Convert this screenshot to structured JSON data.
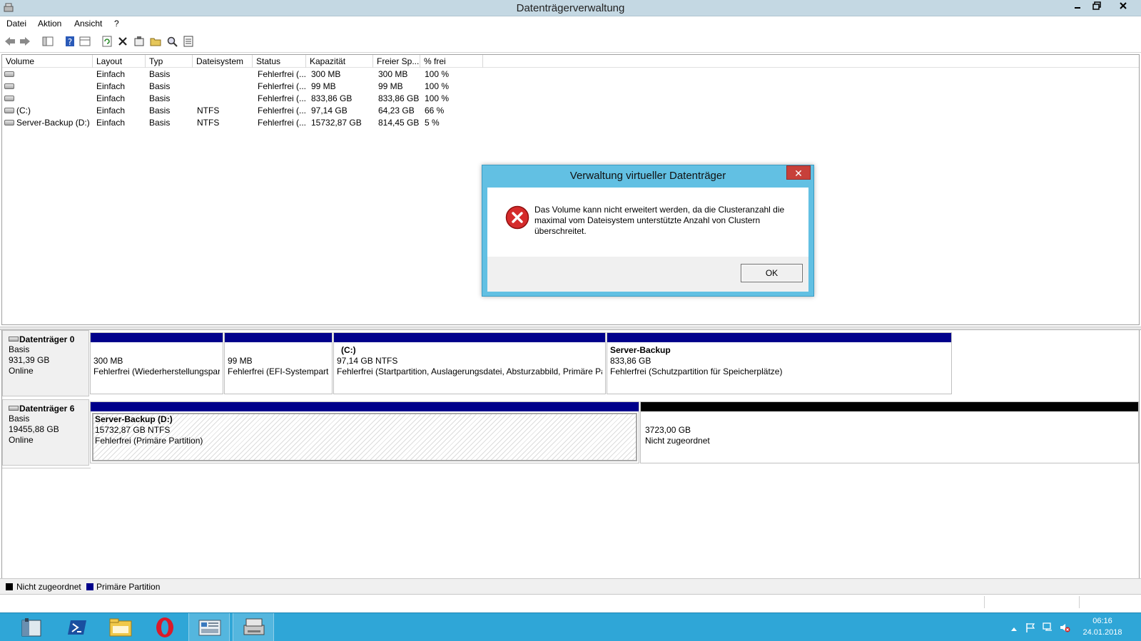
{
  "window": {
    "title": "Datenträgerverwaltung"
  },
  "menu": [
    "Datei",
    "Aktion",
    "Ansicht",
    "?"
  ],
  "volume_table": {
    "headers": [
      "Volume",
      "Layout",
      "Typ",
      "Dateisystem",
      "Status",
      "Kapazität",
      "Freier Sp...",
      "% frei"
    ],
    "rows": [
      [
        "",
        "Einfach",
        "Basis",
        "",
        "Fehlerfrei (...",
        "300 MB",
        "300 MB",
        "100 %"
      ],
      [
        "",
        "Einfach",
        "Basis",
        "",
        "Fehlerfrei (...",
        "99 MB",
        "99 MB",
        "100 %"
      ],
      [
        "",
        "Einfach",
        "Basis",
        "",
        "Fehlerfrei (...",
        "833,86 GB",
        "833,86 GB",
        "100 %"
      ],
      [
        "(C:)",
        "Einfach",
        "Basis",
        "NTFS",
        "Fehlerfrei (...",
        "97,14 GB",
        "64,23 GB",
        "66 %"
      ],
      [
        "Server-Backup (D:)",
        "Einfach",
        "Basis",
        "NTFS",
        "Fehlerfrei (...",
        "15732,87 GB",
        "814,45 GB",
        "5 %"
      ]
    ]
  },
  "disks": [
    {
      "name": "Datenträger 0",
      "type": "Basis",
      "size": "931,39 GB",
      "state": "Online",
      "partitions": [
        {
          "title": "",
          "size": "300 MB",
          "status": "Fehlerfrei (Wiederherstellungspart"
        },
        {
          "title": "",
          "size": "99 MB",
          "status": "Fehlerfrei (EFI-Systempartit"
        },
        {
          "title": "(C:)",
          "size": "97,14 GB NTFS",
          "status": "Fehlerfrei (Startpartition, Auslagerungsdatei, Absturzabbild, Primäre Par"
        },
        {
          "title": "Server-Backup",
          "size": "833,86 GB",
          "status": "Fehlerfrei (Schutzpartition für Speicherplätze)"
        }
      ]
    },
    {
      "name": "Datenträger 6",
      "type": "Basis",
      "size": "19455,88 GB",
      "state": "Online",
      "partitions": [
        {
          "title": "Server-Backup  (D:)",
          "size": "15732,87 GB NTFS",
          "status": "Fehlerfrei (Primäre Partition)"
        },
        {
          "title": "",
          "size": "3723,00 GB",
          "status": "Nicht zugeordnet"
        }
      ]
    }
  ],
  "legend": [
    {
      "label": "Nicht zugeordnet",
      "color": "#000000"
    },
    {
      "label": "Primäre Partition",
      "color": "#00008b"
    }
  ],
  "dialog": {
    "title": "Verwaltung virtueller Datenträger",
    "message": "Das Volume kann nicht erweitert werden, da die Clusteranzahl die maximal vom Dateisystem unterstützte Anzahl von Clustern überschreitet.",
    "ok_label": "OK",
    "close_label": "✕"
  },
  "taskbar": {
    "apps": [
      "server-manager-icon",
      "powershell-icon",
      "file-explorer-icon",
      "opera-icon",
      "control-panel-icon",
      "disk-management-icon"
    ],
    "time": "06:16",
    "date": "24.01.2018"
  },
  "colors": {
    "primary_partition": "#00008b",
    "unallocated": "#000000",
    "taskbar": "#2fa6d7",
    "dialog_frame": "#62c0e3"
  }
}
